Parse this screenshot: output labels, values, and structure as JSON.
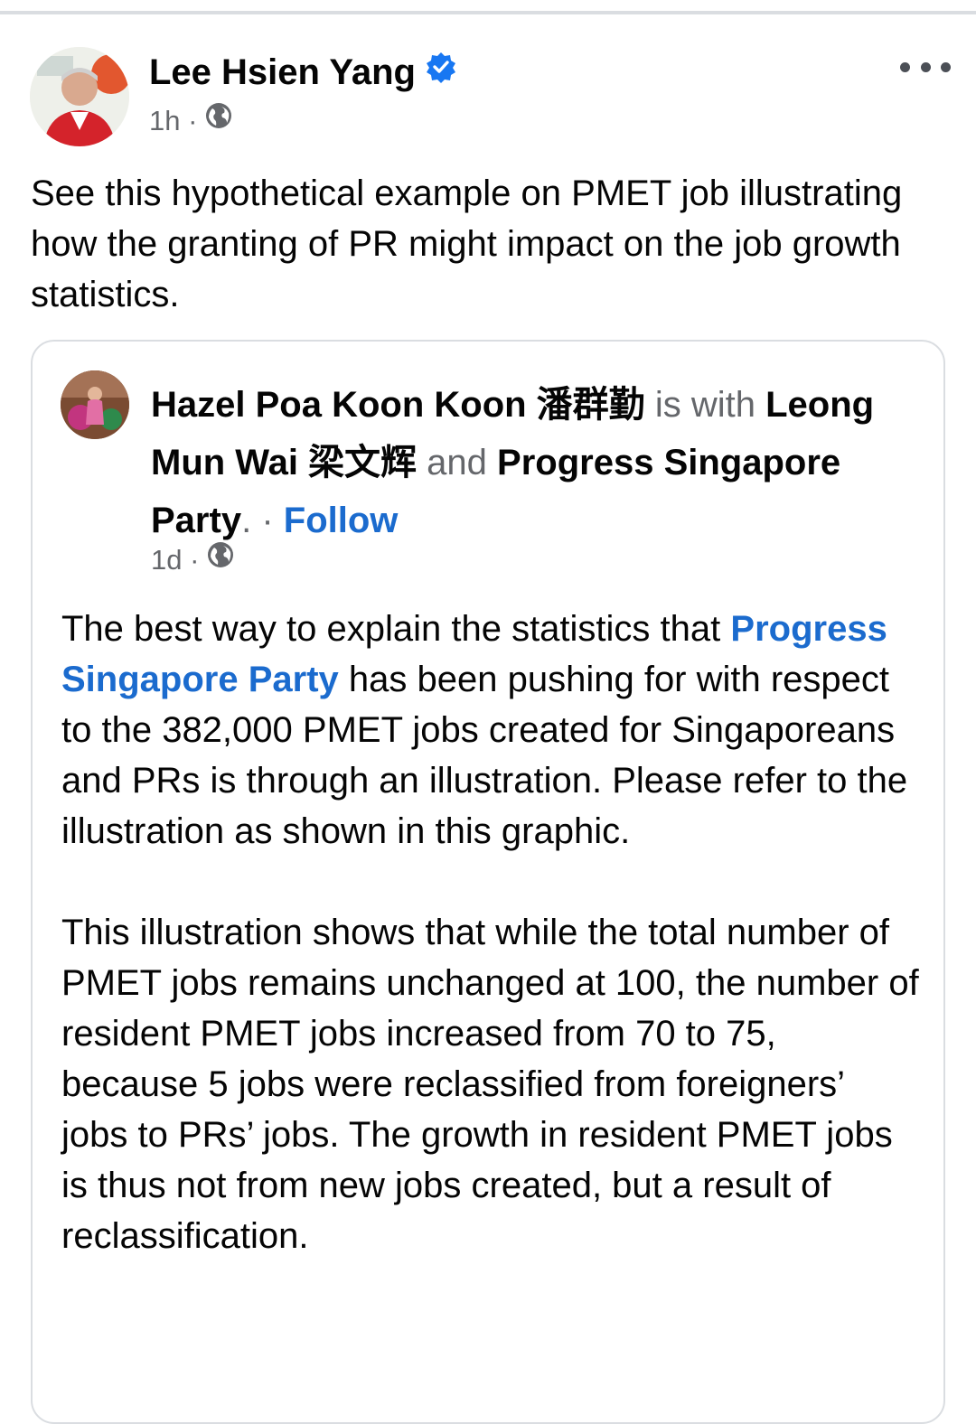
{
  "post": {
    "author": "Lee Hsien Yang",
    "time": "1h",
    "separator": "·",
    "text": "See this hypothetical example on PMET job illustrating how the granting of PR might impact on the job growth statistics."
  },
  "shared": {
    "author": "Hazel Poa Koon Koon 潘群勤",
    "with_text": "is with",
    "tag1": "Leong Mun Wai 梁文辉",
    "and_text": "and",
    "tag2": "Progress Singapore Party",
    "period": ".",
    "follow_sep": "·",
    "follow_label": "Follow",
    "time": "1d",
    "separator": "·",
    "para1_before": "The best way to explain the statistics that",
    "para1_link": "Progress Singapore Party",
    "para1_after": "has been pushing for with respect to the 382,000 PMET jobs created for Singaporeans and PRs is through an illustration.  Please refer to the illustration as shown in this graphic.",
    "para2": "This illustration shows that while the total number of PMET jobs remains unchanged at 100, the number of resident PMET jobs increased from 70 to 75, because 5 jobs were reclassified from foreigners’ jobs to PRs’ jobs. The growth in resident PMET jobs is thus not from new jobs created, but a result of reclassification."
  },
  "colors": {
    "link": "#1b6bce",
    "verified": "#1877f2",
    "meta": "#65676b"
  },
  "icons": [
    "verified-badge-icon",
    "globe-icon",
    "more-options-icon"
  ]
}
